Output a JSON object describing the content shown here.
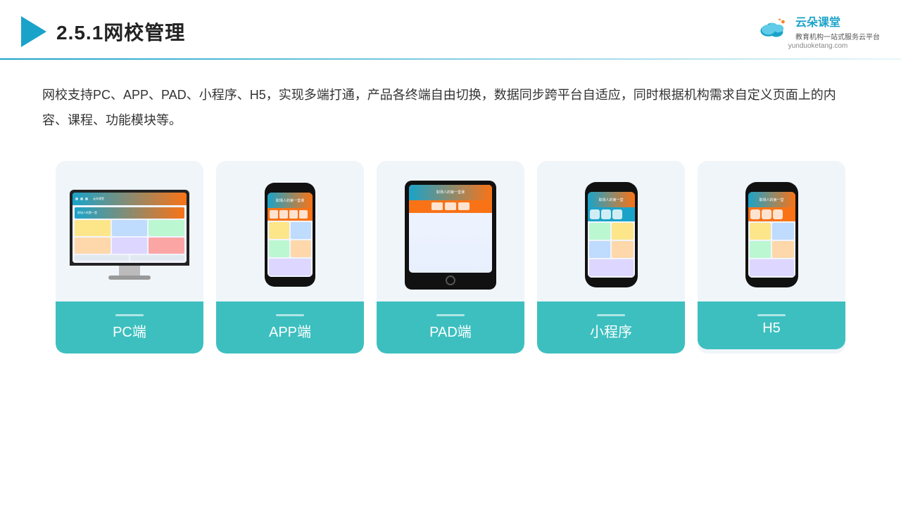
{
  "header": {
    "title": "2.5.1网校管理",
    "logo": {
      "name": "云朵课堂",
      "url": "yunduoketang.com",
      "subtitle": "教育机构一站\n式服务云平台"
    }
  },
  "description": "网校支持PC、APP、PAD、小程序、H5，实现多端打通，产品各终端自由切换，数据同步跨平台自适应，同时根据机构需求自定义页面上的内容、课程、功能模块等。",
  "cards": [
    {
      "id": "pc",
      "label": "PC端",
      "type": "monitor"
    },
    {
      "id": "app",
      "label": "APP端",
      "type": "phone"
    },
    {
      "id": "pad",
      "label": "PAD端",
      "type": "tablet"
    },
    {
      "id": "mini",
      "label": "小程序",
      "type": "phone"
    },
    {
      "id": "h5",
      "label": "H5",
      "type": "phone"
    }
  ],
  "colors": {
    "accent": "#1aa3c9",
    "teal": "#3dbfbf",
    "card_bg": "#eef3f9"
  }
}
